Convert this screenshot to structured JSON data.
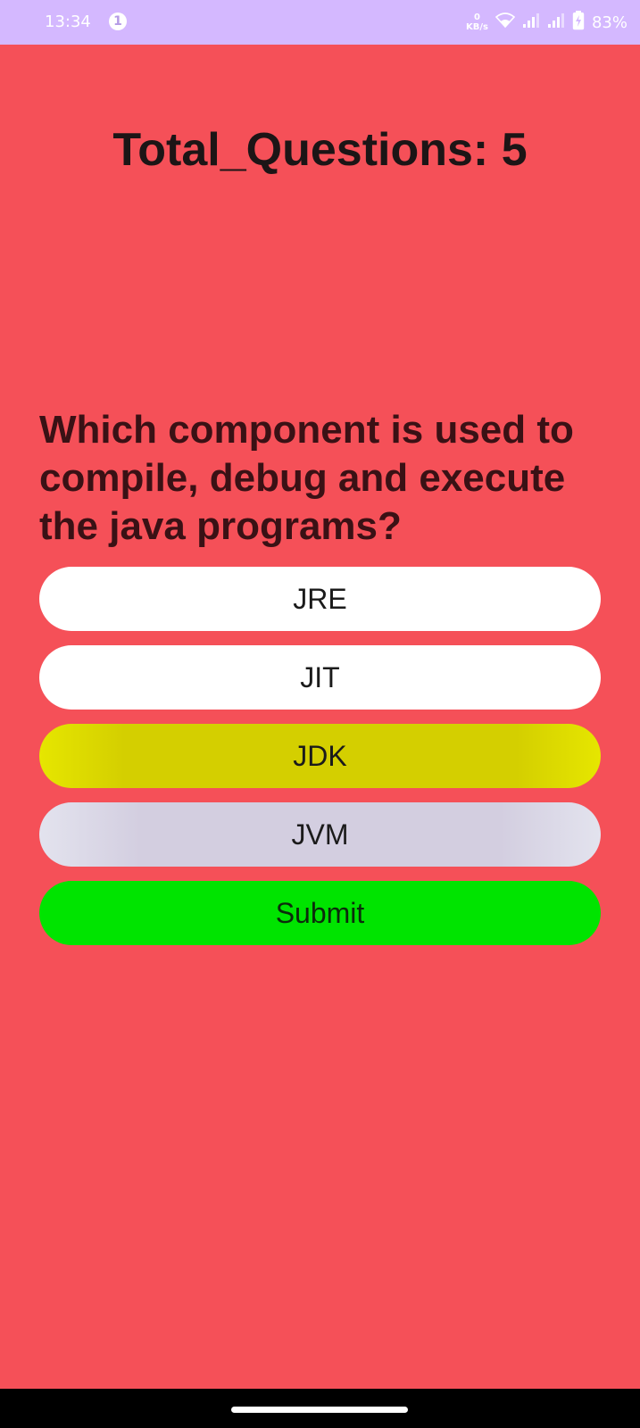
{
  "status_bar": {
    "time": "13:34",
    "notification_count": "1",
    "net_speed_value": "0",
    "net_speed_unit": "KB/s",
    "battery": "83%",
    "icons": [
      "wifi-icon",
      "signal-icon",
      "signal-icon",
      "battery-charging-icon"
    ]
  },
  "quiz": {
    "title": "Total_Questions: 5",
    "question": "Which component is used to compile, debug and execute the java programs?",
    "options": [
      "JRE",
      "JIT",
      "JDK",
      "JVM"
    ],
    "submit_label": "Submit"
  },
  "colors": {
    "background": "#f55058",
    "status_bar": "#d4b8ff",
    "option_default": "#ffffff",
    "option_highlight_yellow": "#d4cf00",
    "option_highlight_lavender": "#d3cee0",
    "submit": "#00e400"
  }
}
